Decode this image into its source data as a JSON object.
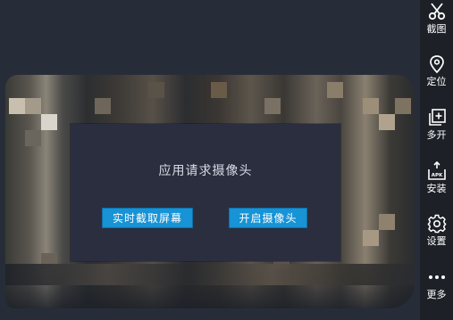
{
  "dialog": {
    "title": "应用请求摄像头",
    "btn_screen": "实时截取屏幕",
    "btn_camera": "开启摄像头"
  },
  "sidebar": {
    "items": [
      {
        "label": "截图",
        "icon": "scissors-icon"
      },
      {
        "label": "定位",
        "icon": "location-pin-icon"
      },
      {
        "label": "多开",
        "icon": "multi-window-icon"
      },
      {
        "label": "安装",
        "icon": "apk-install-icon"
      },
      {
        "label": "设置",
        "icon": "gear-icon"
      },
      {
        "label": "更多",
        "icon": "more-dots-icon"
      }
    ]
  },
  "colors": {
    "accent": "#1793d6",
    "dialog_bg": "#2a2e3f",
    "sidebar_bg": "#1d2027",
    "app_bg": "#272c36"
  }
}
